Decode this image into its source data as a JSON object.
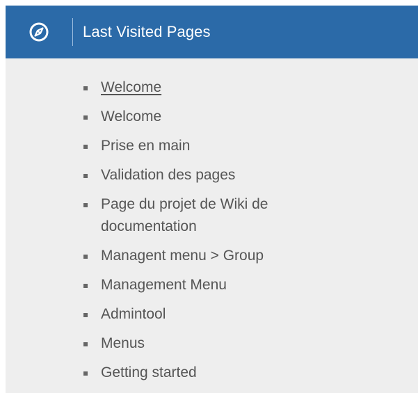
{
  "colors": {
    "header_bg": "#2b6aa8",
    "panel_bg": "#eeeeee",
    "text": "#555555"
  },
  "header": {
    "icon": "compass-icon",
    "title": "Last Visited Pages"
  },
  "pages": [
    {
      "label": "Welcome",
      "current": true
    },
    {
      "label": "Welcome",
      "current": false
    },
    {
      "label": "Prise en main",
      "current": false
    },
    {
      "label": "Validation des pages",
      "current": false
    },
    {
      "label": "Page du projet de Wiki de documentation",
      "current": false
    },
    {
      "label": "Managent menu > Group",
      "current": false
    },
    {
      "label": "Management Menu",
      "current": false
    },
    {
      "label": "Admintool",
      "current": false
    },
    {
      "label": "Menus",
      "current": false
    },
    {
      "label": "Getting started",
      "current": false
    }
  ]
}
